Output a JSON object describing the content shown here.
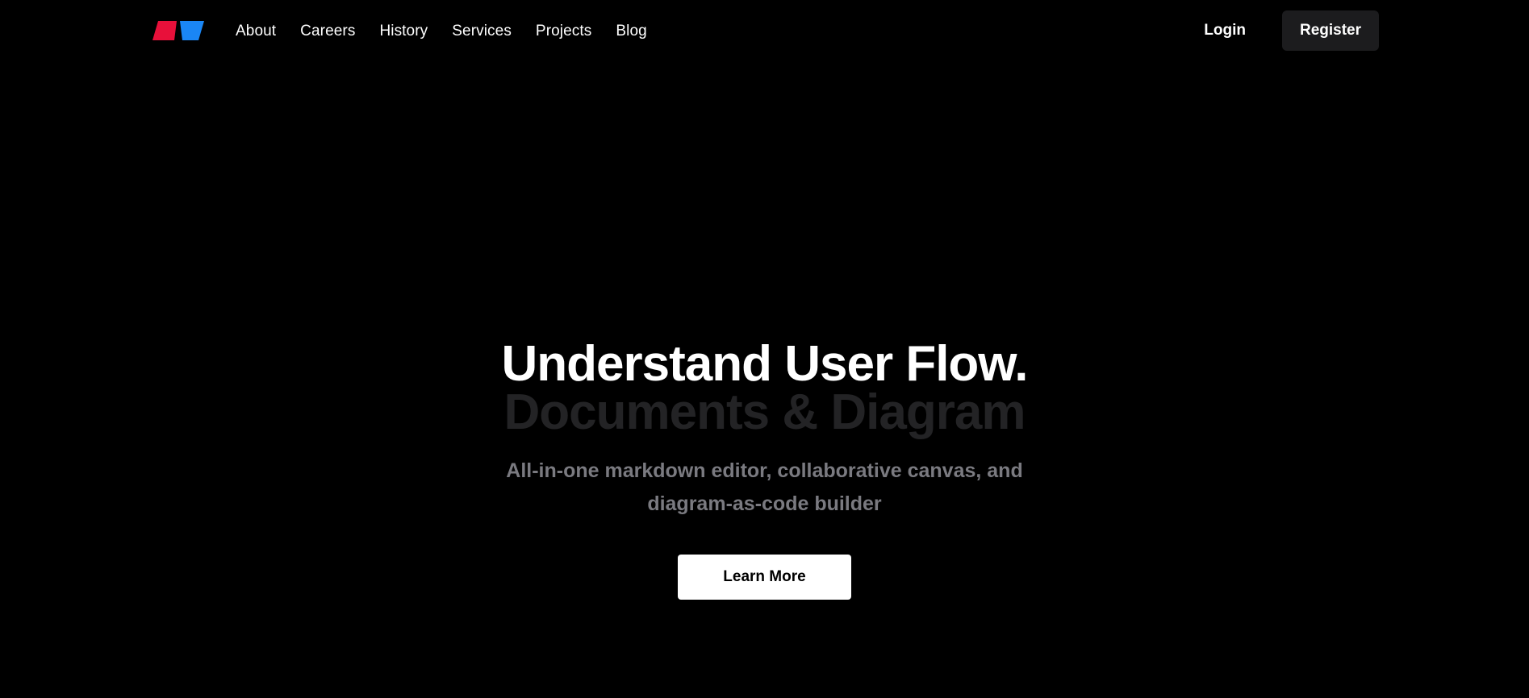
{
  "logo": {
    "icon": "brand-logo-parallelograms",
    "colors": [
      "#e8103a",
      "#1a86f5"
    ]
  },
  "nav": {
    "items": [
      {
        "label": "About"
      },
      {
        "label": "Careers"
      },
      {
        "label": "History"
      },
      {
        "label": "Services"
      },
      {
        "label": "Projects"
      },
      {
        "label": "Blog"
      }
    ],
    "login_label": "Login",
    "register_label": "Register"
  },
  "hero": {
    "title": "Understand User Flow.",
    "subtitle": "Documents & Diagram",
    "description": "All-in-one markdown editor, collaborative canvas, and diagram-as-code builder",
    "cta_label": "Learn More"
  },
  "colors": {
    "background": "#000000",
    "text": "#ffffff",
    "subtitle": "#232325",
    "description": "#7a7a80",
    "register_bg": "#1c1c1e"
  }
}
